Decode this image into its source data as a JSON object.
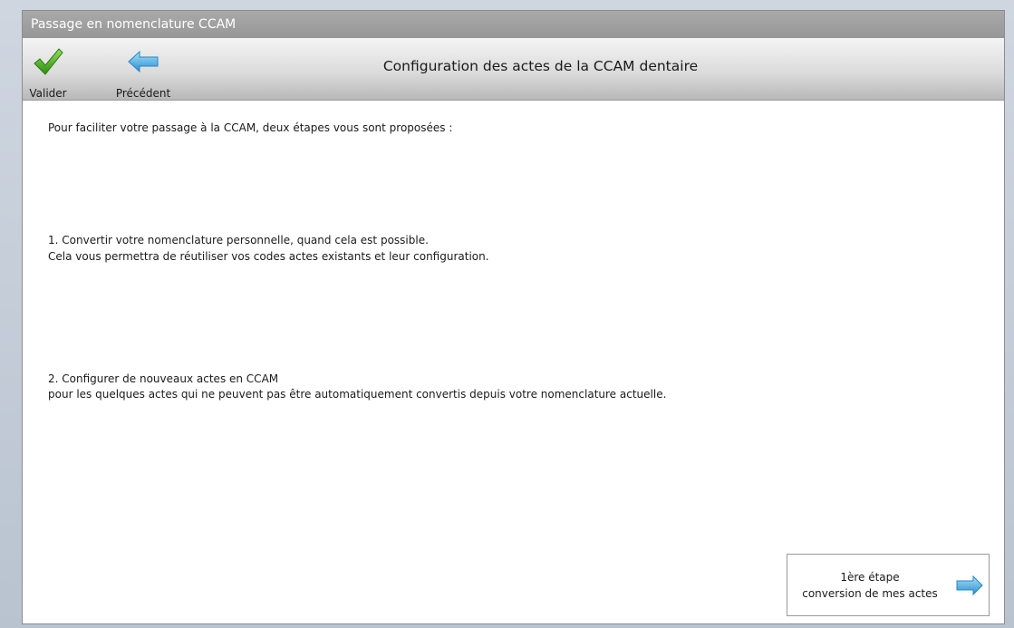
{
  "window": {
    "title": "Passage en nomenclature CCAM"
  },
  "toolbar": {
    "title": "Configuration des actes de la CCAM dentaire",
    "valider_label": "Valider",
    "precedent_label": "Précédent"
  },
  "content": {
    "intro": "Pour faciliter votre passage à la CCAM, deux étapes vous sont proposées :",
    "step1_line1": "1. Convertir votre nomenclature personnelle, quand cela est possible.",
    "step1_line2": "Cela vous permettra de réutiliser vos codes actes existants et leur configuration.",
    "step2_line1": "2. Configurer de nouveaux actes en CCAM",
    "step2_line2": "pour les quelques actes qui ne peuvent pas être automatiquement convertis depuis votre nomenclature actuelle."
  },
  "next_button": {
    "line1": "1ère étape",
    "line2": "conversion de mes actes"
  },
  "icons": {
    "valider": "checkmark-icon",
    "precedent": "arrow-left-icon",
    "next": "arrow-right-icon"
  },
  "colors": {
    "check_green": "#4caf1f",
    "arrow_blue": "#3aa9e0",
    "titlebar_gray": "#a0a0a0"
  }
}
